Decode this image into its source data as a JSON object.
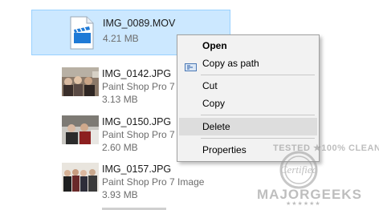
{
  "files": [
    {
      "name": "IMG_0089.MOV",
      "type": "",
      "size": "4.21 MB",
      "selected": true,
      "icon": "video-file-icon"
    },
    {
      "name": "IMG_0142.JPG",
      "type": "Paint Shop Pro 7",
      "size": "3.13 MB",
      "selected": false,
      "icon": "photo-thumbnail"
    },
    {
      "name": "IMG_0150.JPG",
      "type": "Paint Shop Pro 7",
      "size": "2.60 MB",
      "selected": false,
      "icon": "photo-thumbnail"
    },
    {
      "name": "IMG_0157.JPG",
      "type": "Paint Shop Pro 7 Image",
      "size": "3.93 MB",
      "selected": false,
      "icon": "photo-thumbnail"
    }
  ],
  "context_menu": {
    "items": [
      {
        "label": "Open",
        "bold": true
      },
      {
        "label": "Copy as path",
        "icon": "copy-path-icon"
      },
      {
        "label": "Cut"
      },
      {
        "label": "Copy"
      },
      {
        "label": "Delete",
        "highlighted": true
      },
      {
        "label": "Properties"
      }
    ]
  },
  "watermark": {
    "line1": "TESTED ★100% CLEAN",
    "stamp_text": "Certified",
    "line2": "MAJORGEEKS",
    "stars": "★★★★★★"
  },
  "colors": {
    "selection_bg": "#cce8ff",
    "selection_border": "#99d1ff",
    "menu_bg": "#f2f2f2",
    "menu_highlight": "#dddddd",
    "secondary_text": "#6d6d6d"
  }
}
